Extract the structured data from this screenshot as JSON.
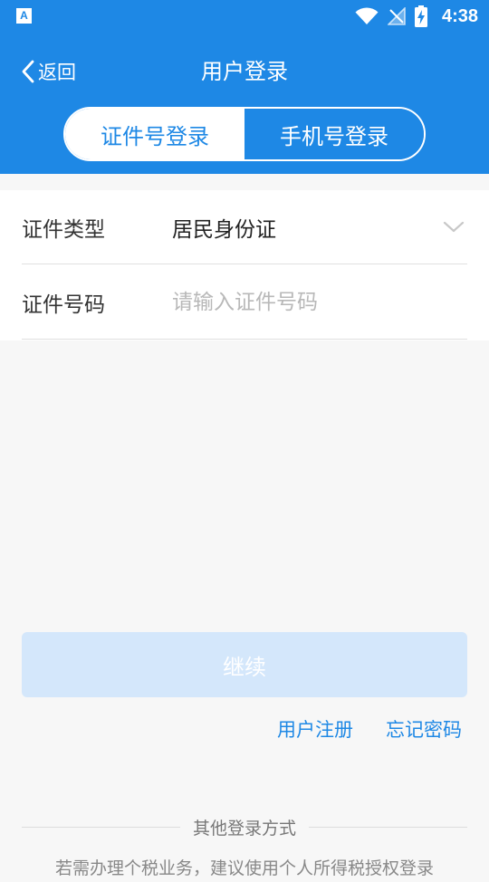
{
  "status_bar": {
    "app_icon_letter": "A",
    "time": "4:38"
  },
  "nav": {
    "back_label": "返回",
    "title": "用户登录"
  },
  "tabs": [
    {
      "label": "证件号登录",
      "active": true
    },
    {
      "label": "手机号登录",
      "active": false
    }
  ],
  "form": {
    "id_type_label": "证件类型",
    "id_type_value": "居民身份证",
    "id_number_label": "证件号码",
    "id_number_placeholder": "请输入证件号码",
    "id_number_value": ""
  },
  "actions": {
    "continue_label": "继续",
    "register_label": "用户注册",
    "forgot_label": "忘记密码"
  },
  "other": {
    "divider_label": "其他登录方式",
    "note": "若需办理个税业务，建议使用个人所得税授权登录"
  },
  "colors": {
    "primary": "#1e88e5",
    "button_disabled": "#d4e7fb",
    "background": "#f7f7f7"
  },
  "icons": {
    "back": "chevron-left-icon",
    "dropdown": "chevron-down-icon",
    "wifi": "wifi-icon",
    "signal": "no-signal-icon",
    "battery": "battery-charging-icon"
  }
}
